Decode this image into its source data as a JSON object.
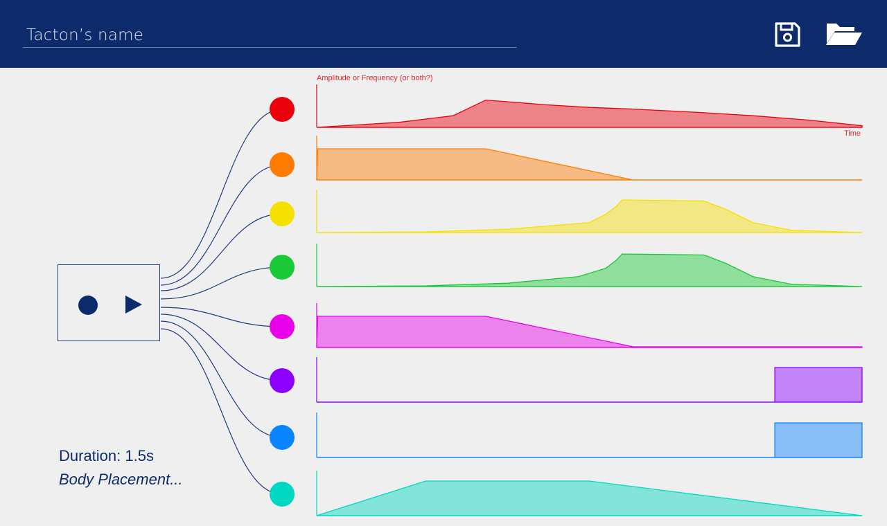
{
  "header": {
    "tacton_name_placeholder": "Tacton’s name",
    "save_icon": "floppy-disk",
    "open_icon": "folder-open"
  },
  "device": {
    "record_icon": "record-dot",
    "play_icon": "play-triangle"
  },
  "info": {
    "duration": "Duration: 1.5s",
    "body_placement": "Body Placement..."
  },
  "axes": {
    "ylabel": "Amplitude or Frequency (or both?)",
    "xlabel": "Time"
  },
  "colors": {
    "header_bg": "#0d2b6b",
    "accent": "#0d2b6b",
    "background": "#efefef"
  },
  "channels": [
    {
      "color": "#e8000b",
      "shape": [
        [
          0,
          0.0
        ],
        [
          0.05,
          0.05
        ],
        [
          0.15,
          0.15
        ],
        [
          0.25,
          0.35
        ],
        [
          0.31,
          0.82
        ],
        [
          0.35,
          0.77
        ],
        [
          0.42,
          0.68
        ],
        [
          0.5,
          0.6
        ],
        [
          0.58,
          0.55
        ],
        [
          0.7,
          0.45
        ],
        [
          0.8,
          0.35
        ],
        [
          0.9,
          0.22
        ],
        [
          1,
          0.05
        ]
      ]
    },
    {
      "color": "#ff7c00",
      "shape": [
        [
          0,
          0.0
        ],
        [
          0.002,
          0.9
        ],
        [
          0.31,
          0.9
        ],
        [
          0.58,
          0.0
        ],
        [
          1,
          0.0
        ]
      ]
    },
    {
      "color": "#f5e100",
      "shape": [
        [
          0,
          0.0
        ],
        [
          0.2,
          0.02
        ],
        [
          0.35,
          0.1
        ],
        [
          0.5,
          0.3
        ],
        [
          0.53,
          0.55
        ],
        [
          0.55,
          0.8
        ],
        [
          0.56,
          0.98
        ],
        [
          0.71,
          0.95
        ],
        [
          0.75,
          0.7
        ],
        [
          0.8,
          0.3
        ],
        [
          0.87,
          0.07
        ],
        [
          1,
          0.0
        ]
      ]
    },
    {
      "color": "#1ac938",
      "shape": [
        [
          0,
          0.0
        ],
        [
          0.2,
          0.02
        ],
        [
          0.35,
          0.1
        ],
        [
          0.48,
          0.3
        ],
        [
          0.53,
          0.55
        ],
        [
          0.55,
          0.8
        ],
        [
          0.56,
          0.98
        ],
        [
          0.71,
          0.95
        ],
        [
          0.75,
          0.7
        ],
        [
          0.8,
          0.3
        ],
        [
          0.87,
          0.07
        ],
        [
          1,
          0.0
        ]
      ]
    },
    {
      "color": "#e800e8",
      "shape": [
        [
          0,
          0.0
        ],
        [
          0.002,
          0.9
        ],
        [
          0.31,
          0.9
        ],
        [
          0.58,
          0.02
        ],
        [
          1,
          0.02
        ]
      ]
    },
    {
      "color": "#8b00ff",
      "shape": [
        [
          0,
          0.0
        ],
        [
          0.84,
          0.0
        ],
        [
          0.84,
          0.98
        ],
        [
          1,
          0.98
        ],
        [
          1,
          0.0
        ]
      ]
    },
    {
      "color": "#0a84ff",
      "shape": [
        [
          0,
          0.0
        ],
        [
          0.84,
          0.0
        ],
        [
          0.84,
          0.98
        ],
        [
          1,
          0.98
        ],
        [
          1,
          0.0
        ]
      ]
    },
    {
      "color": "#00d7c0",
      "shape": [
        [
          0,
          0.0
        ],
        [
          0.2,
          0.98
        ],
        [
          0.5,
          0.98
        ],
        [
          1,
          0.0
        ]
      ]
    }
  ]
}
